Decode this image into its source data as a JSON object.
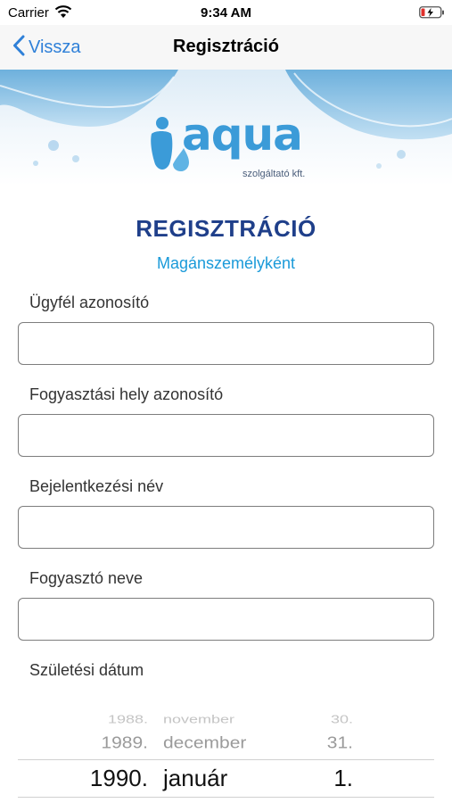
{
  "status_bar": {
    "carrier": "Carrier",
    "time": "9:34 AM"
  },
  "nav": {
    "back_label": "Vissza",
    "title": "Regisztráció"
  },
  "logo": {
    "brand": "aqua",
    "tagline": "szolgáltató kft."
  },
  "form": {
    "heading": "REGISZTRÁCIÓ",
    "subheading": "Magánszemélyként",
    "fields": [
      {
        "label": "Ügyfél azonosító",
        "value": ""
      },
      {
        "label": "Fogyasztási hely azonosító",
        "value": ""
      },
      {
        "label": "Bejelentkezési név",
        "value": ""
      },
      {
        "label": "Fogyasztó neve",
        "value": ""
      }
    ],
    "birth_date": {
      "label": "Születési dátum",
      "rows": [
        {
          "year": "1988.",
          "month": "november",
          "day": "30."
        },
        {
          "year": "1989.",
          "month": "december",
          "day": "31."
        },
        {
          "year": "1990.",
          "month": "január",
          "day": "1."
        }
      ],
      "selected": {
        "year": "1990.",
        "month": "január",
        "day": "1."
      }
    }
  },
  "colors": {
    "accent": "#2f80d8",
    "heading": "#1f3f8a",
    "subheading": "#1a9ad9",
    "logo": "#3b9bd8"
  }
}
